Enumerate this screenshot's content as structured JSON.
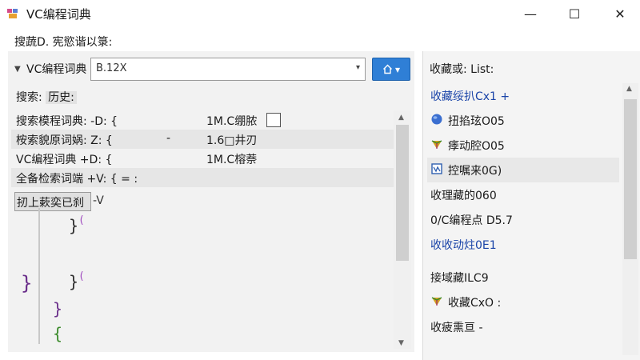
{
  "window": {
    "title": "VC编程词典",
    "minimize_glyph": "—",
    "maximize_glyph": "☐",
    "close_glyph": "✕"
  },
  "menu": {
    "label": "搜蔬D. 宪慾谐以箓:"
  },
  "tree": {
    "toggle_glyph": "▼",
    "label": "VC编程词典"
  },
  "search": {
    "value": "B.12X",
    "dropdown_glyph": "▾"
  },
  "home_button": {
    "icon": "home-icon",
    "dropdown_glyph": "▾"
  },
  "section": {
    "label": "搜索:",
    "tab": "历史:"
  },
  "list": {
    "rows": [
      {
        "text": "搜索模程词典: -D: {",
        "dash": "",
        "value": "1M.C绷脓",
        "check": true
      },
      {
        "text": "桉索貌原词娲: Z: {",
        "dash": "-",
        "value": "1.6□井刃",
        "check": false
      },
      {
        "text": "VC编程词典 +D: {",
        "dash": "",
        "value": "1M.C榕萘",
        "check": false
      },
      {
        "text": "全备检索词端 +V: { = :",
        "dash": "",
        "value": "",
        "check": false
      }
    ]
  },
  "history": {
    "button_label": "扨上蔌奕已刹",
    "suffix": "-V"
  },
  "code": [
    {
      "text": "}",
      "color": "#2e2e2e"
    },
    {
      "text": "(",
      "color": "#a04cc0"
    },
    {
      "text": "}",
      "color": "#6a2e8a"
    },
    {
      "text": "}",
      "color": "#2e2e2e"
    },
    {
      "text": "(",
      "color": "#a04cc0"
    },
    {
      "text": "}",
      "color": "#6a2e8a"
    },
    {
      "text": "{",
      "color": "#3a8a2a"
    }
  ],
  "favorites": {
    "header": "收藏或: List:",
    "items": [
      {
        "label": "收藏绥扒Cx1 +",
        "icon": "none",
        "style": "link"
      },
      {
        "label": "扭掐玹O05",
        "icon": "globe-icon",
        "style": "normal"
      },
      {
        "label": "痵动腔O05",
        "icon": "gem-icon",
        "style": "normal"
      },
      {
        "label": "控嘱来0G)",
        "icon": "doc-icon",
        "style": "selected"
      },
      {
        "label": "收理藏的060",
        "icon": "none",
        "style": "normal"
      },
      {
        "label": "0/C编程点 D5.7",
        "icon": "none",
        "style": "normal"
      },
      {
        "label": "收收动炷0E1",
        "icon": "none",
        "style": "link"
      },
      {
        "label": "接域藏ILC9",
        "icon": "none",
        "style": "divider-before"
      },
      {
        "label": "收藏CxO :",
        "icon": "gem-icon",
        "style": "normal"
      },
      {
        "label": "收疲熏亘 -",
        "icon": "none",
        "style": "normal"
      }
    ]
  },
  "colors": {
    "accent": "#2f7fd6",
    "link": "#1a44a8",
    "panel_bg": "#f2f2f2"
  }
}
